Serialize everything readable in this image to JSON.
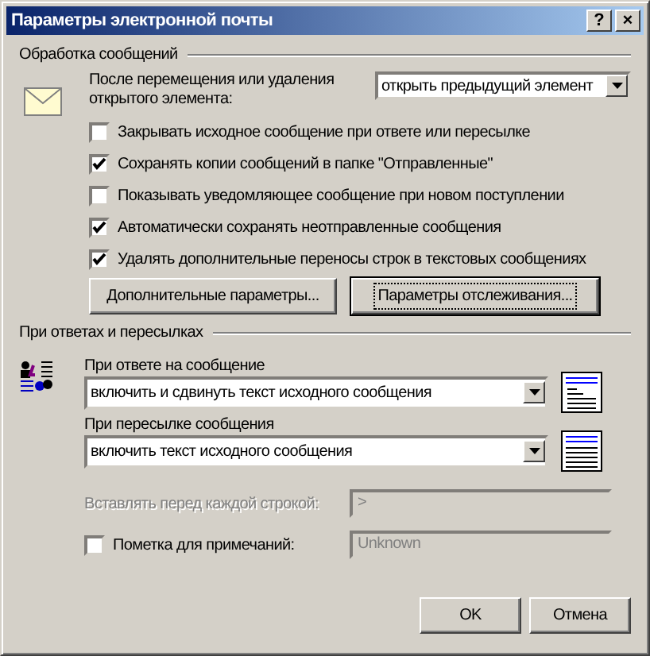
{
  "window": {
    "title": "Параметры электронной почты",
    "controls": [
      "?",
      "×"
    ]
  },
  "message_handling": {
    "title": "Обработка сообщений",
    "after_move": {
      "label": "После перемещения или удаления открытого элемента:",
      "value": "открыть предыдущий элемент"
    },
    "options": [
      {
        "label": "Закрывать исходное сообщение при ответе или пересылке",
        "checked": false
      },
      {
        "label": "Сохранять копии сообщений в папке \"Отправленные\"",
        "checked": true
      },
      {
        "label": "Показывать уведомляющее сообщение при новом поступлении",
        "checked": false
      },
      {
        "label": "Автоматически сохранять неотправленные сообщения",
        "checked": true
      },
      {
        "label": "Удалять дополнительные переносы строк в текстовых сообщениях",
        "checked": true
      }
    ],
    "buttons": [
      {
        "label": "Дополнительные параметры...",
        "focused": false
      },
      {
        "label": "Параметры отслеживания...",
        "focused": true
      }
    ]
  },
  "replies": {
    "title": "При ответах и пересылках",
    "reply": {
      "label": "При ответе на сообщение",
      "value": "включить и сдвинуть текст исходного сообщения",
      "indented": true
    },
    "forward": {
      "label": "При пересылке сообщения",
      "value": "включить текст исходного сообщения",
      "indented": false
    },
    "prefix": {
      "label": "Вставлять перед каждой строкой:",
      "value": ">",
      "disabled": true
    },
    "mark": {
      "label": "Пометка для примечаний:",
      "checked": false,
      "value": "Unknown",
      "disabled": true
    }
  },
  "buttons": [
    "OK",
    "Отмена"
  ]
}
